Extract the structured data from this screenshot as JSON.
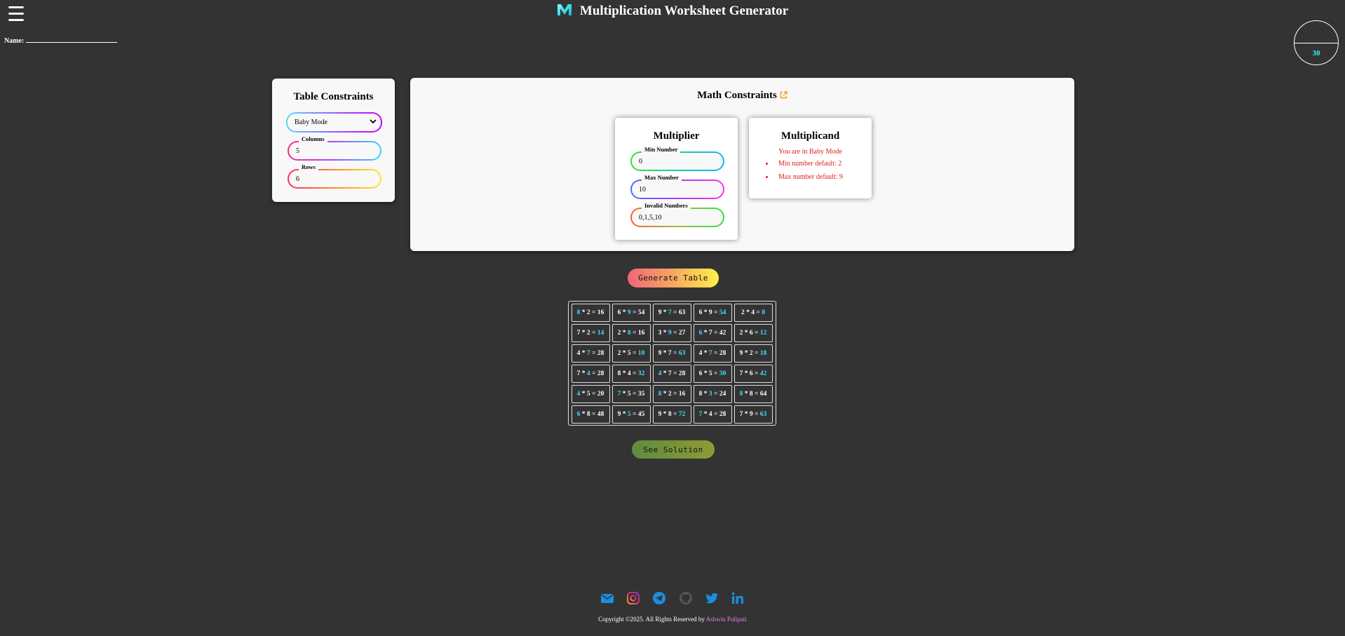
{
  "header": {
    "title": "Multiplication Worksheet Generator"
  },
  "name_label": "Name:",
  "timer": {
    "value": "30"
  },
  "table_constraints": {
    "title": "Table Constraints",
    "mode_selected": "Baby Mode",
    "columns_label": "Columns",
    "columns_value": "5",
    "rows_label": "Rows",
    "rows_value": "6"
  },
  "math_constraints": {
    "title": "Math Constraints",
    "multiplier": {
      "title": "Multiplier",
      "min_label": "Min Number",
      "min_value": "0",
      "max_label": "Max Number",
      "max_value": "10",
      "invalid_label": "Invalid Numbers",
      "invalid_value": "0,1,5,10"
    },
    "multiplicand": {
      "title": "Multiplicand",
      "notice": "You are in Baby Mode",
      "min_default": "Min number default: 2",
      "max_default": "Max number default: 9"
    }
  },
  "buttons": {
    "generate": "Generate Table",
    "solution": "See Solution"
  },
  "worksheet": [
    [
      {
        "a": "8",
        "b": "2",
        "r": "16",
        "h": "a"
      },
      {
        "a": "6",
        "b": "9",
        "r": "54",
        "h": "b"
      },
      {
        "a": "9",
        "b": "7",
        "r": "63",
        "h": "b"
      },
      {
        "a": "6",
        "b": "9",
        "r": "54",
        "h": "r"
      },
      {
        "a": "2",
        "b": "4",
        "r": "8",
        "h": "r"
      }
    ],
    [
      {
        "a": "7",
        "b": "2",
        "r": "14",
        "h": "r"
      },
      {
        "a": "2",
        "b": "8",
        "r": "16",
        "h": "b"
      },
      {
        "a": "3",
        "b": "9",
        "r": "27",
        "h": "b"
      },
      {
        "a": "6",
        "b": "7",
        "r": "42",
        "h": "a"
      },
      {
        "a": "2",
        "b": "6",
        "r": "12",
        "h": "r"
      }
    ],
    [
      {
        "a": "4",
        "b": "7",
        "r": "28",
        "h": "b"
      },
      {
        "a": "2",
        "b": "5",
        "r": "10",
        "h": "r"
      },
      {
        "a": "9",
        "b": "7",
        "r": "63",
        "h": "r"
      },
      {
        "a": "4",
        "b": "7",
        "r": "28",
        "h": "b"
      },
      {
        "a": "9",
        "b": "2",
        "r": "18",
        "h": "r"
      }
    ],
    [
      {
        "a": "7",
        "b": "4",
        "r": "28",
        "h": "b"
      },
      {
        "a": "8",
        "b": "4",
        "r": "32",
        "h": "r"
      },
      {
        "a": "4",
        "b": "7",
        "r": "28",
        "h": "a"
      },
      {
        "a": "6",
        "b": "5",
        "r": "30",
        "h": "r"
      },
      {
        "a": "7",
        "b": "6",
        "r": "42",
        "h": "r"
      }
    ],
    [
      {
        "a": "4",
        "b": "5",
        "r": "20",
        "h": "a"
      },
      {
        "a": "7",
        "b": "5",
        "r": "35",
        "h": "a"
      },
      {
        "a": "8",
        "b": "2",
        "r": "16",
        "h": "a"
      },
      {
        "a": "8",
        "b": "3",
        "r": "24",
        "h": "b"
      },
      {
        "a": "8",
        "b": "8",
        "r": "64",
        "h": "a"
      }
    ],
    [
      {
        "a": "6",
        "b": "8",
        "r": "48",
        "h": "a"
      },
      {
        "a": "9",
        "b": "5",
        "r": "45",
        "h": "b"
      },
      {
        "a": "9",
        "b": "8",
        "r": "72",
        "h": "r"
      },
      {
        "a": "7",
        "b": "4",
        "r": "28",
        "h": "a"
      },
      {
        "a": "7",
        "b": "9",
        "r": "63",
        "h": "r"
      }
    ]
  ],
  "footer": {
    "icons": [
      "mail-icon",
      "instagram-icon",
      "telegram-icon",
      "github-icon",
      "twitter-icon",
      "linkedin-icon"
    ],
    "copyright": "Copyright ©2025. All Rights Reserved by",
    "author": "Ashwin Pulipati"
  },
  "colors": {
    "background": "#333333",
    "highlight": "#3ee0ff",
    "error": "#e0201a",
    "author": "#e27be8"
  }
}
